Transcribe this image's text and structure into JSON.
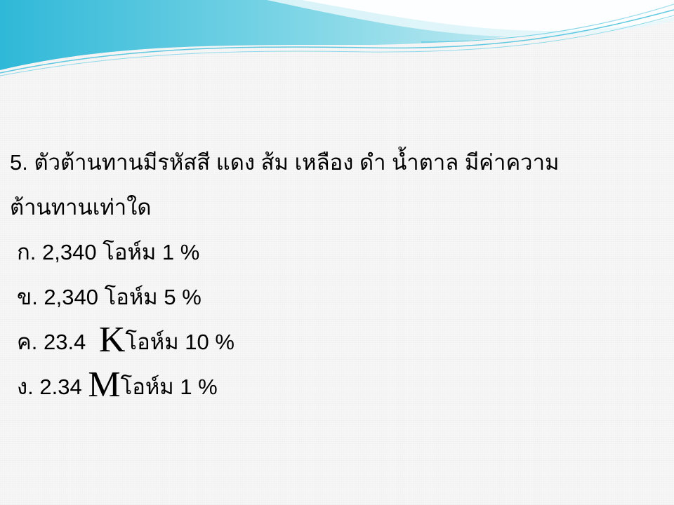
{
  "question": {
    "line1": "5. ตัวต้านทานมีรหัสสี แดง ส้ม เหลือง ดำ น้ำตาล มีค่าความ",
    "line2": "ต้านทานเท่าใด"
  },
  "choices": [
    {
      "prefix": "ก. 2,340 โอห์ม  1 %"
    },
    {
      "prefix": "ข. 2,340 โอห์ม 5 %"
    },
    {
      "prefix": "ค. 23.4 ",
      "unit_letter": "K",
      "suffix": "โอห์ม 10 %"
    },
    {
      "prefix": "ง. 2.34 ",
      "unit_letter": "M",
      "suffix": "โอห์ม  1 %"
    }
  ],
  "theme_colors": {
    "wave_dark": "#2fb8d8",
    "wave_light": "#9fe3ee",
    "wave_white": "#ffffff"
  }
}
